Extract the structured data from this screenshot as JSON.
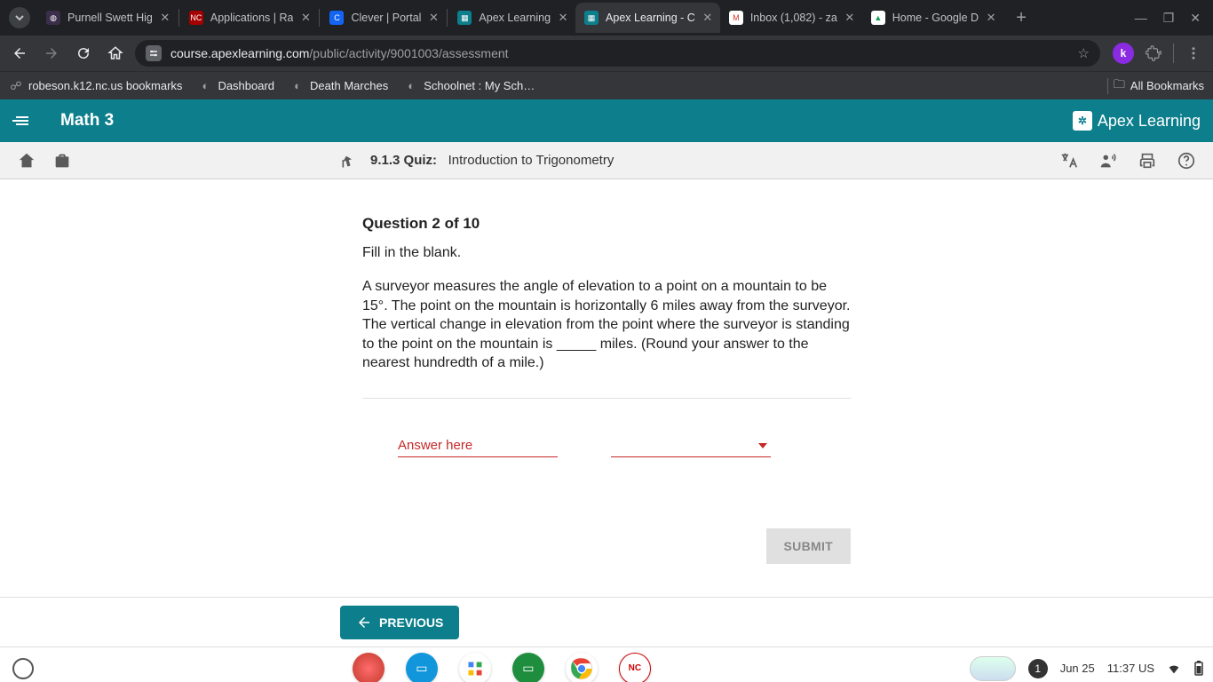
{
  "browser": {
    "tabs": [
      {
        "title": "Purnell Swett Hig",
        "favicon_bg": "#3b2e4a",
        "favicon_text": "◍"
      },
      {
        "title": "Applications | Ra",
        "favicon_bg": "#a50000",
        "favicon_text": "NC"
      },
      {
        "title": "Clever | Portal",
        "favicon_bg": "#1464f4",
        "favicon_text": "C"
      },
      {
        "title": "Apex Learning",
        "favicon_bg": "#0d7f8c",
        "favicon_text": "▦"
      },
      {
        "title": "Apex Learning - C",
        "favicon_bg": "#0d7f8c",
        "favicon_text": "▦",
        "active": true
      },
      {
        "title": "Inbox (1,082) - za",
        "favicon_bg": "#ffffff",
        "favicon_text": "M"
      },
      {
        "title": "Home - Google D",
        "favicon_bg": "#ffffff",
        "favicon_text": "▲"
      }
    ],
    "url_host": "course.apexlearning.com",
    "url_path": "/public/activity/9001003/assessment",
    "bookmarks": [
      "robeson.k12.nc.us bookmarks",
      "Dashboard",
      "Death Marches",
      "Schoolnet : My Sch…"
    ],
    "all_bookmarks_label": "All Bookmarks",
    "ext_letter": "k"
  },
  "apex": {
    "course": "Math 3",
    "brand": "Apex Learning",
    "crumb_code": "9.1.3",
    "crumb_kind": "Quiz:",
    "crumb_title": "Introduction to Trigonometry"
  },
  "question": {
    "header": "Question 2 of 10",
    "instruction": "Fill in the blank.",
    "body": "A surveyor measures the angle of elevation to a point on a mountain to be 15°. The point on the mountain is horizontally 6 miles away from the surveyor. The vertical change in elevation from the point where the surveyor is standing to the point on the mountain is _____ miles. (Round your answer to the nearest hundredth of a mile.)",
    "answer_placeholder": "Answer here",
    "submit_label": "SUBMIT",
    "previous_label": "PREVIOUS"
  },
  "shelf": {
    "notif_count": "1",
    "date": "Jun 25",
    "time": "11:37",
    "locale": "US"
  }
}
